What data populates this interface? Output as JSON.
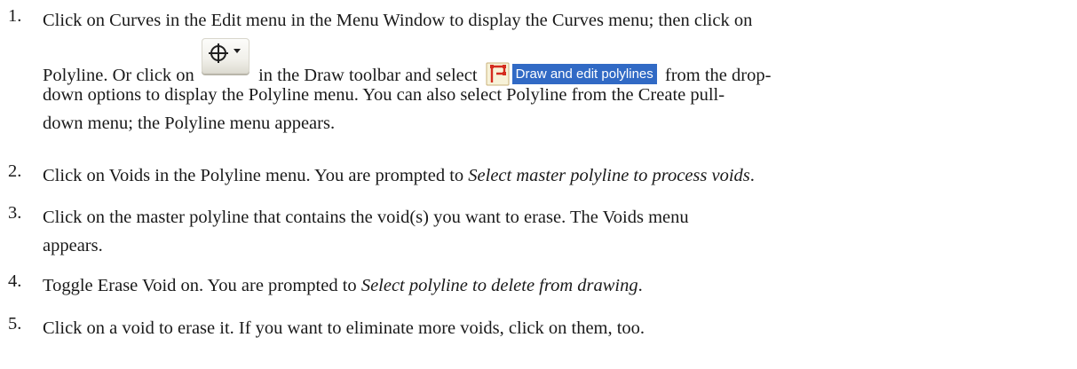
{
  "steps": [
    {
      "number": "1.",
      "line1": "Click on Curves in the Edit menu in the Menu Window to display the Curves menu; then click on",
      "line2_before": "Polyline. Or click on",
      "line2_middle": "in the Draw toolbar and select",
      "dropdown_option_label": "Draw and edit polylines",
      "line2_after": "from the drop-",
      "line3": "down options to display the Polyline menu. You can also select Polyline from the Create pull-",
      "line4": "down menu; the Polyline menu appears."
    },
    {
      "number": "2.",
      "text": "Click on Voids in the Polyline menu. You are prompted to ",
      "prompt": "Select master polyline to process voids",
      "end": "."
    },
    {
      "number": "3.",
      "line1": "Click on the master polyline that contains the void(s) you want to erase. The Voids menu",
      "line2": "appears."
    },
    {
      "number": "4.",
      "text": "Toggle Erase Void on. You are prompted to ",
      "prompt": "Select polyline to delete from drawing",
      "end": "."
    },
    {
      "number": "5.",
      "text": "Click on a void to erase it. If you want to eliminate more voids, click on them, too."
    }
  ],
  "icons": {
    "toolbar_button": "crosshair-circle-dropdown-icon",
    "dropdown_option": "polyline-icon"
  },
  "colors": {
    "text": "#1a1a1a",
    "selection_background": "#316ac5",
    "polyline_icon_red": "#d42b1e"
  }
}
